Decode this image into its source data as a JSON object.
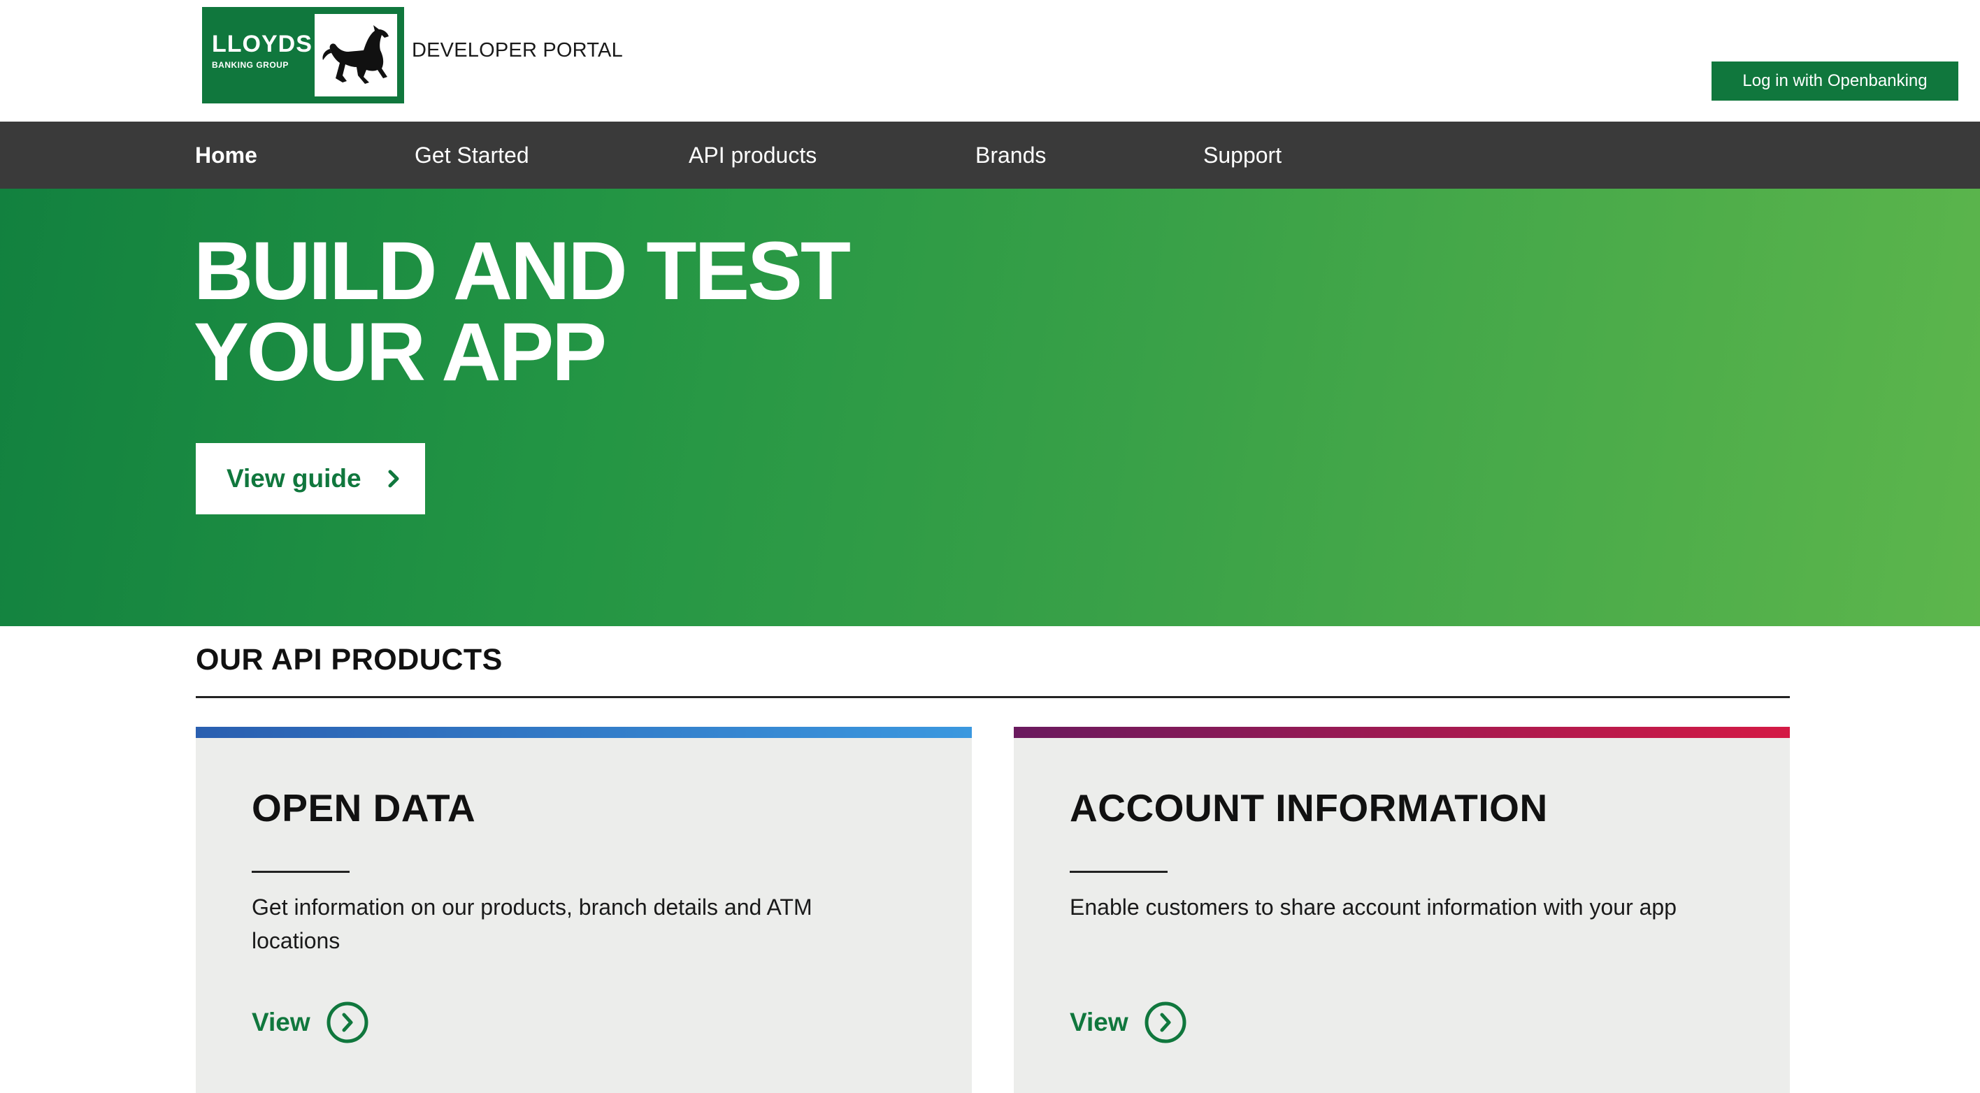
{
  "header": {
    "logo": {
      "name": "LLOYDS",
      "subtitle": "BANKING GROUP",
      "icon": "black-horse-icon"
    },
    "portal_label": "DEVELOPER PORTAL",
    "login_button": "Log in with Openbanking"
  },
  "nav": {
    "items": [
      {
        "label": "Home",
        "active": true
      },
      {
        "label": "Get Started",
        "active": false
      },
      {
        "label": "API products",
        "active": false
      },
      {
        "label": "Brands",
        "active": false
      },
      {
        "label": "Support",
        "active": false
      }
    ]
  },
  "hero": {
    "title_line1": "BUILD AND TEST",
    "title_line2": "YOUR APP",
    "button_label": "View guide",
    "button_icon": "chevron-right-icon"
  },
  "products": {
    "section_title": "OUR API PRODUCTS",
    "cards": [
      {
        "title": "OPEN DATA",
        "description": "Get information on our products, branch details and ATM locations",
        "link_label": "View",
        "link_icon": "circle-chevron-right-icon",
        "accent_from": "#2a5fb0",
        "accent_to": "#3b98df"
      },
      {
        "title": "ACCOUNT INFORMATION",
        "description": "Enable customers to share account information with your app",
        "link_label": "View",
        "link_icon": "circle-chevron-right-icon",
        "accent_from": "#6a1a5e",
        "accent_to": "#d41a45"
      }
    ]
  },
  "colors": {
    "brand_green": "#10773d",
    "nav_background": "#3a3a3a",
    "card_background": "#ecedeb"
  }
}
